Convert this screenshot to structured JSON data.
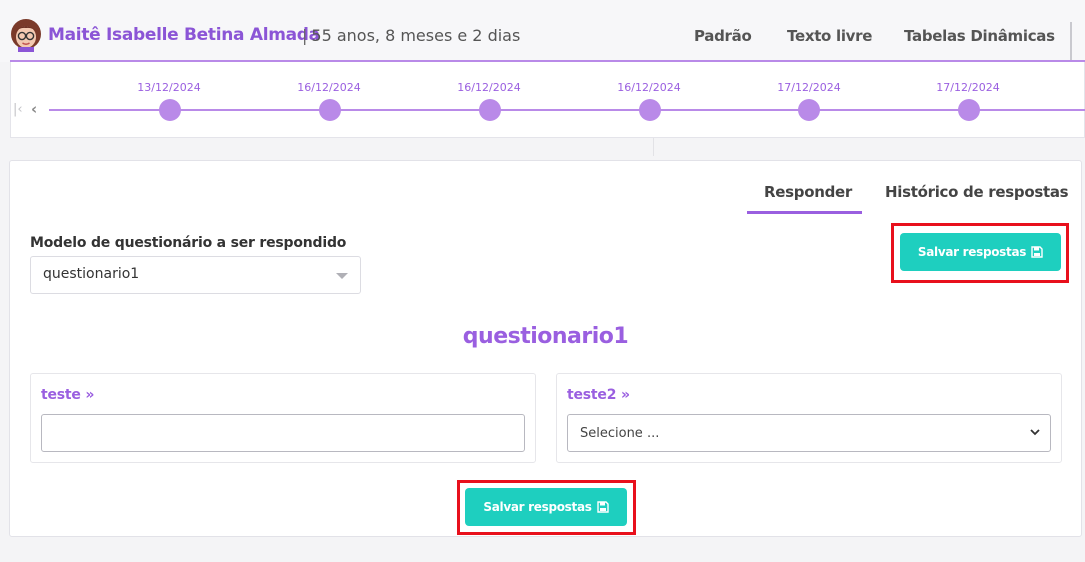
{
  "header": {
    "patient_name": "Maitê Isabelle Betina Almada",
    "separator": "|",
    "patient_age": "55 anos, 8 meses e 2 dias",
    "tabs": [
      {
        "label": "Padrão"
      },
      {
        "label": "Texto livre"
      },
      {
        "label": "Tabelas Dinâmicas"
      }
    ]
  },
  "timeline": {
    "first_icon": "first-page-icon",
    "prev_icon": "chevron-left-icon",
    "dates": [
      "13/12/2024",
      "16/12/2024",
      "16/12/2024",
      "16/12/2024",
      "17/12/2024",
      "17/12/2024"
    ]
  },
  "panel": {
    "tabs": [
      {
        "label": "Responder",
        "active": true
      },
      {
        "label": "Histórico de respostas",
        "active": false
      }
    ],
    "model_label": "Modelo de questionário a ser respondido",
    "model_value": "questionario1",
    "save_label": "Salvar respostas",
    "form_title": "questionario1",
    "fields": [
      {
        "label": "teste",
        "marker": "»",
        "type": "text",
        "value": ""
      },
      {
        "label": "teste2",
        "marker": "»",
        "type": "select",
        "value": "Selecione ..."
      }
    ]
  },
  "colors": {
    "accent": "#9a5fe0",
    "button": "#1ecfbf",
    "highlight": "#e8101c"
  }
}
